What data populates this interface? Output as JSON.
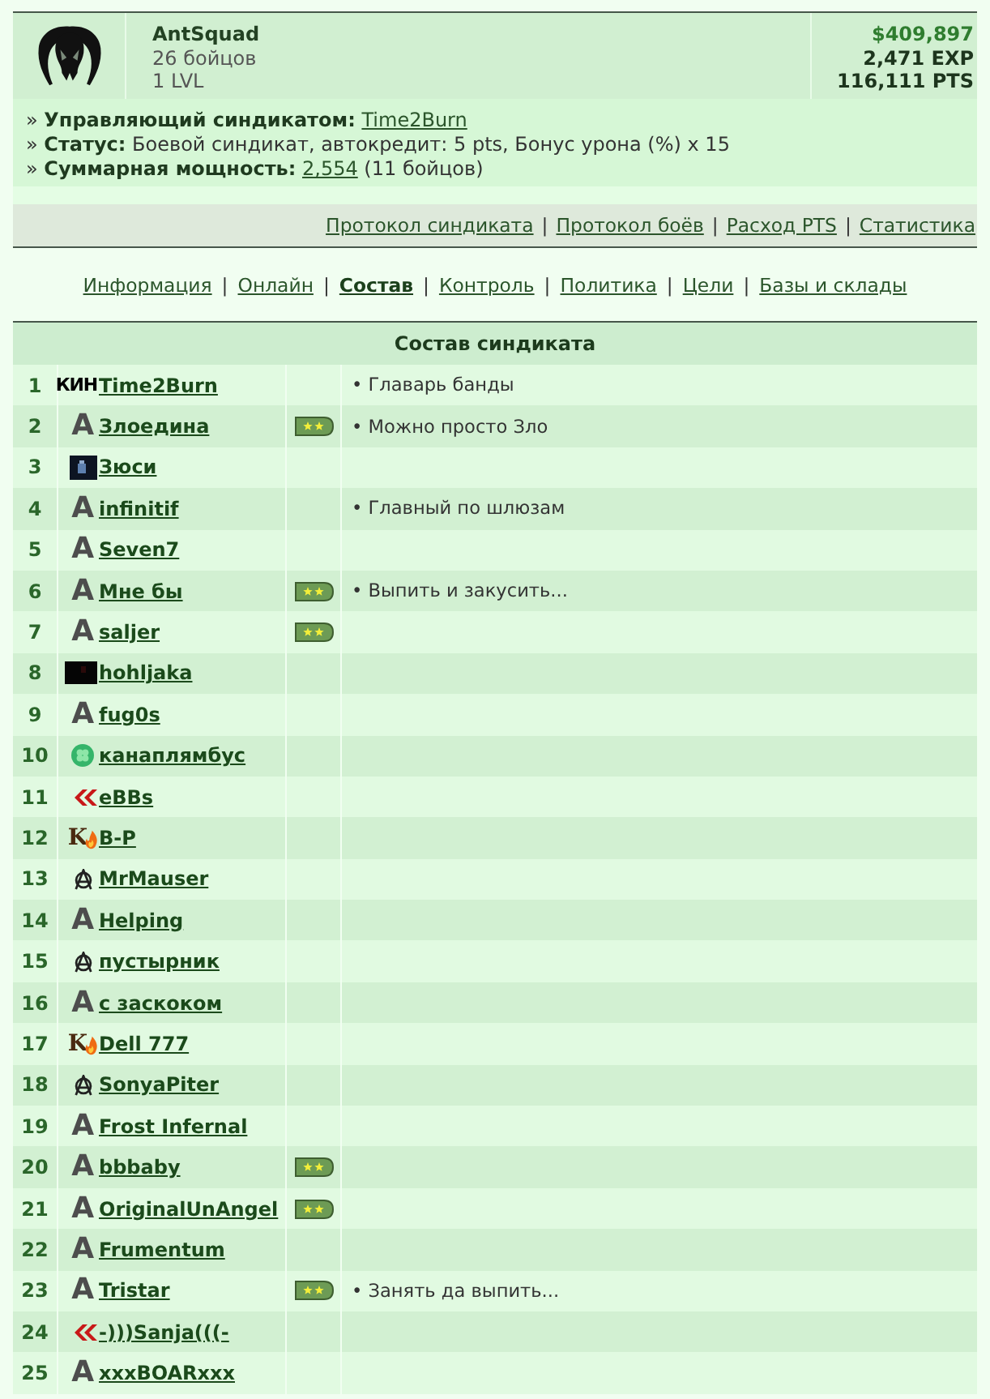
{
  "syndicate": {
    "name": "AntSquad",
    "members": "26 бойцов",
    "level": "1 LVL",
    "money": "$409,897",
    "exp": "2,471 EXP",
    "pts": "116,111 PTS"
  },
  "info": [
    {
      "lead": "» **Управляющий синдикатом:**",
      "link": "Time2Burn"
    },
    {
      "lead": "» **Статус:** Боевой синдикат, автокредит: 5 pts, Бонус урона (%) x 15"
    },
    {
      "lead": "» **Суммарная мощность:**",
      "link": "2,554",
      "tail": "(11 бойцов)"
    }
  ],
  "tools": {
    "separator": "|",
    "links": [
      "Протокол синдиката",
      "Протокол боёв",
      "Расход PTS",
      "Статистика"
    ]
  },
  "nav": {
    "separator": "|",
    "tabs": [
      {
        "label": "Информация",
        "selected": false
      },
      {
        "label": "Онлайн",
        "selected": false
      },
      {
        "label": "Состав",
        "selected": true
      },
      {
        "label": "Контроль",
        "selected": false
      },
      {
        "label": "Политика",
        "selected": false
      },
      {
        "label": "Цели",
        "selected": false
      },
      {
        "label": "Базы и склады",
        "selected": false
      }
    ]
  },
  "table": {
    "title": "Состав синдиката",
    "rows": [
      {
        "number": "1",
        "kind": "tag",
        "icon_text": "КИН",
        "name": "Time2Burn",
        "rank_badge": false,
        "note": "• Главарь банды"
      },
      {
        "number": "2",
        "kind": "letter",
        "icon_text": "A",
        "name": "Злоедина",
        "rank_badge": true,
        "note": "• Можно просто Зло"
      },
      {
        "number": "3",
        "kind": "avatar",
        "name": "Зюси",
        "rank_badge": false
      },
      {
        "number": "4",
        "kind": "letter",
        "icon_text": "A",
        "name": "infinitif",
        "rank_badge": false,
        "note": "• Главный по шлюзам"
      },
      {
        "number": "5",
        "kind": "letter",
        "icon_text": "A",
        "name": "Seven7",
        "rank_badge": false
      },
      {
        "number": "6",
        "kind": "letter",
        "icon_text": "A",
        "name": "Мне бы",
        "rank_badge": true,
        "note": "• Выпить и закусить..."
      },
      {
        "number": "7",
        "kind": "letter",
        "icon_text": "A",
        "name": "saljer",
        "rank_badge": true
      },
      {
        "number": "8",
        "kind": "block",
        "name": "hohljaka",
        "rank_badge": false
      },
      {
        "number": "9",
        "kind": "letter",
        "icon_text": "A",
        "name": "fug0s",
        "rank_badge": false
      },
      {
        "number": "10",
        "kind": "clover",
        "name": "канаплямбус",
        "rank_badge": false
      },
      {
        "number": "11",
        "kind": "chevrons",
        "name": "eBBs",
        "rank_badge": false
      },
      {
        "number": "12",
        "kind": "flame",
        "icon_text": "K",
        "name": "B-P",
        "rank_badge": false
      },
      {
        "number": "13",
        "kind": "anarchy",
        "name": "MrMauser",
        "rank_badge": false
      },
      {
        "number": "14",
        "kind": "letter",
        "icon_text": "A",
        "name": "Helping",
        "rank_badge": false
      },
      {
        "number": "15",
        "kind": "anarchy",
        "name": "пустырник",
        "rank_badge": false
      },
      {
        "number": "16",
        "kind": "letter",
        "icon_text": "A",
        "name": "с заскоком",
        "rank_badge": false
      },
      {
        "number": "17",
        "kind": "flame",
        "icon_text": "K",
        "name": "Dell 777",
        "rank_badge": false
      },
      {
        "number": "18",
        "kind": "anarchy",
        "name": "SonyaPiter",
        "rank_badge": false
      },
      {
        "number": "19",
        "kind": "letter",
        "icon_text": "A",
        "name": "Frost Infernal",
        "rank_badge": false
      },
      {
        "number": "20",
        "kind": "letter",
        "icon_text": "A",
        "name": "bbbaby",
        "rank_badge": true
      },
      {
        "number": "21",
        "kind": "letter",
        "icon_text": "A",
        "name": "OriginalUnAngel",
        "rank_badge": true
      },
      {
        "number": "22",
        "kind": "letter",
        "icon_text": "A",
        "name": "Frumentum",
        "rank_badge": false
      },
      {
        "number": "23",
        "kind": "letter",
        "icon_text": "A",
        "name": "Tristar",
        "rank_badge": true,
        "note": "• Занять да выпить..."
      },
      {
        "number": "24",
        "kind": "chevrons",
        "name": "-)))Sanja(((-",
        "rank_badge": false
      },
      {
        "number": "25",
        "kind": "letter",
        "icon_text": "A",
        "name": "xxxBOARxxx",
        "rank_badge": false
      }
    ]
  }
}
